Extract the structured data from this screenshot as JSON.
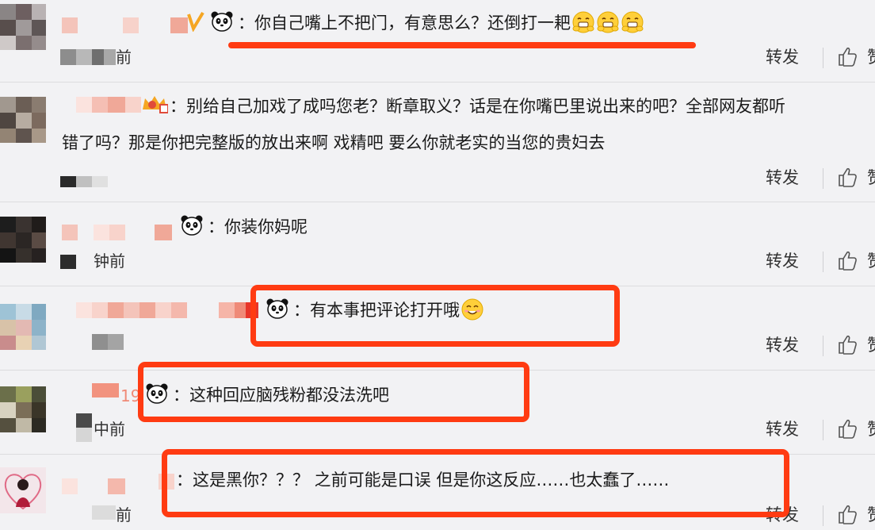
{
  "comments": [
    {
      "text": "你自己嘴上不把门，有意思么？还倒打一耙",
      "time_fragment": "前",
      "repost_label": "转发",
      "like_label": "赞"
    },
    {
      "text_line1": "别给自己加戏了成吗您老？断章取义？话是在你嘴巴里说出来的吧？全部网友都听",
      "text_line2": "错了吗？那是你把完整版的放出来啊 戏精吧 要么你就老实的当您的贵妇去",
      "repost_label": "转发",
      "like_label": "赞"
    },
    {
      "text": "你装你妈呢",
      "time_fragment": "钟前",
      "repost_label": "转发",
      "like_label": "赞"
    },
    {
      "text": "有本事把评论打开哦",
      "repost_label": "转发",
      "like_label": "赞"
    },
    {
      "text": "这种回应脑残粉都没法洗吧",
      "name_fragment": "19",
      "time_fragment": "中前",
      "repost_label": "转发",
      "like_label": "赞"
    },
    {
      "text": "这是黑你？？？ 之前可能是口误 但是你这反应……也太蠢了……",
      "time_fragment": "前",
      "repost_label": "转发",
      "like_label": "赞"
    }
  ],
  "colors": {
    "annotation": "#ff3b12",
    "background": "#f2f2f4",
    "text": "#1a1a1a"
  },
  "icons": {
    "panda": "panda-emoji-icon",
    "emoji_grin": "grinning-face-icon",
    "emoji_smile": "smiling-face-icon",
    "like": "thumbs-up-icon"
  }
}
